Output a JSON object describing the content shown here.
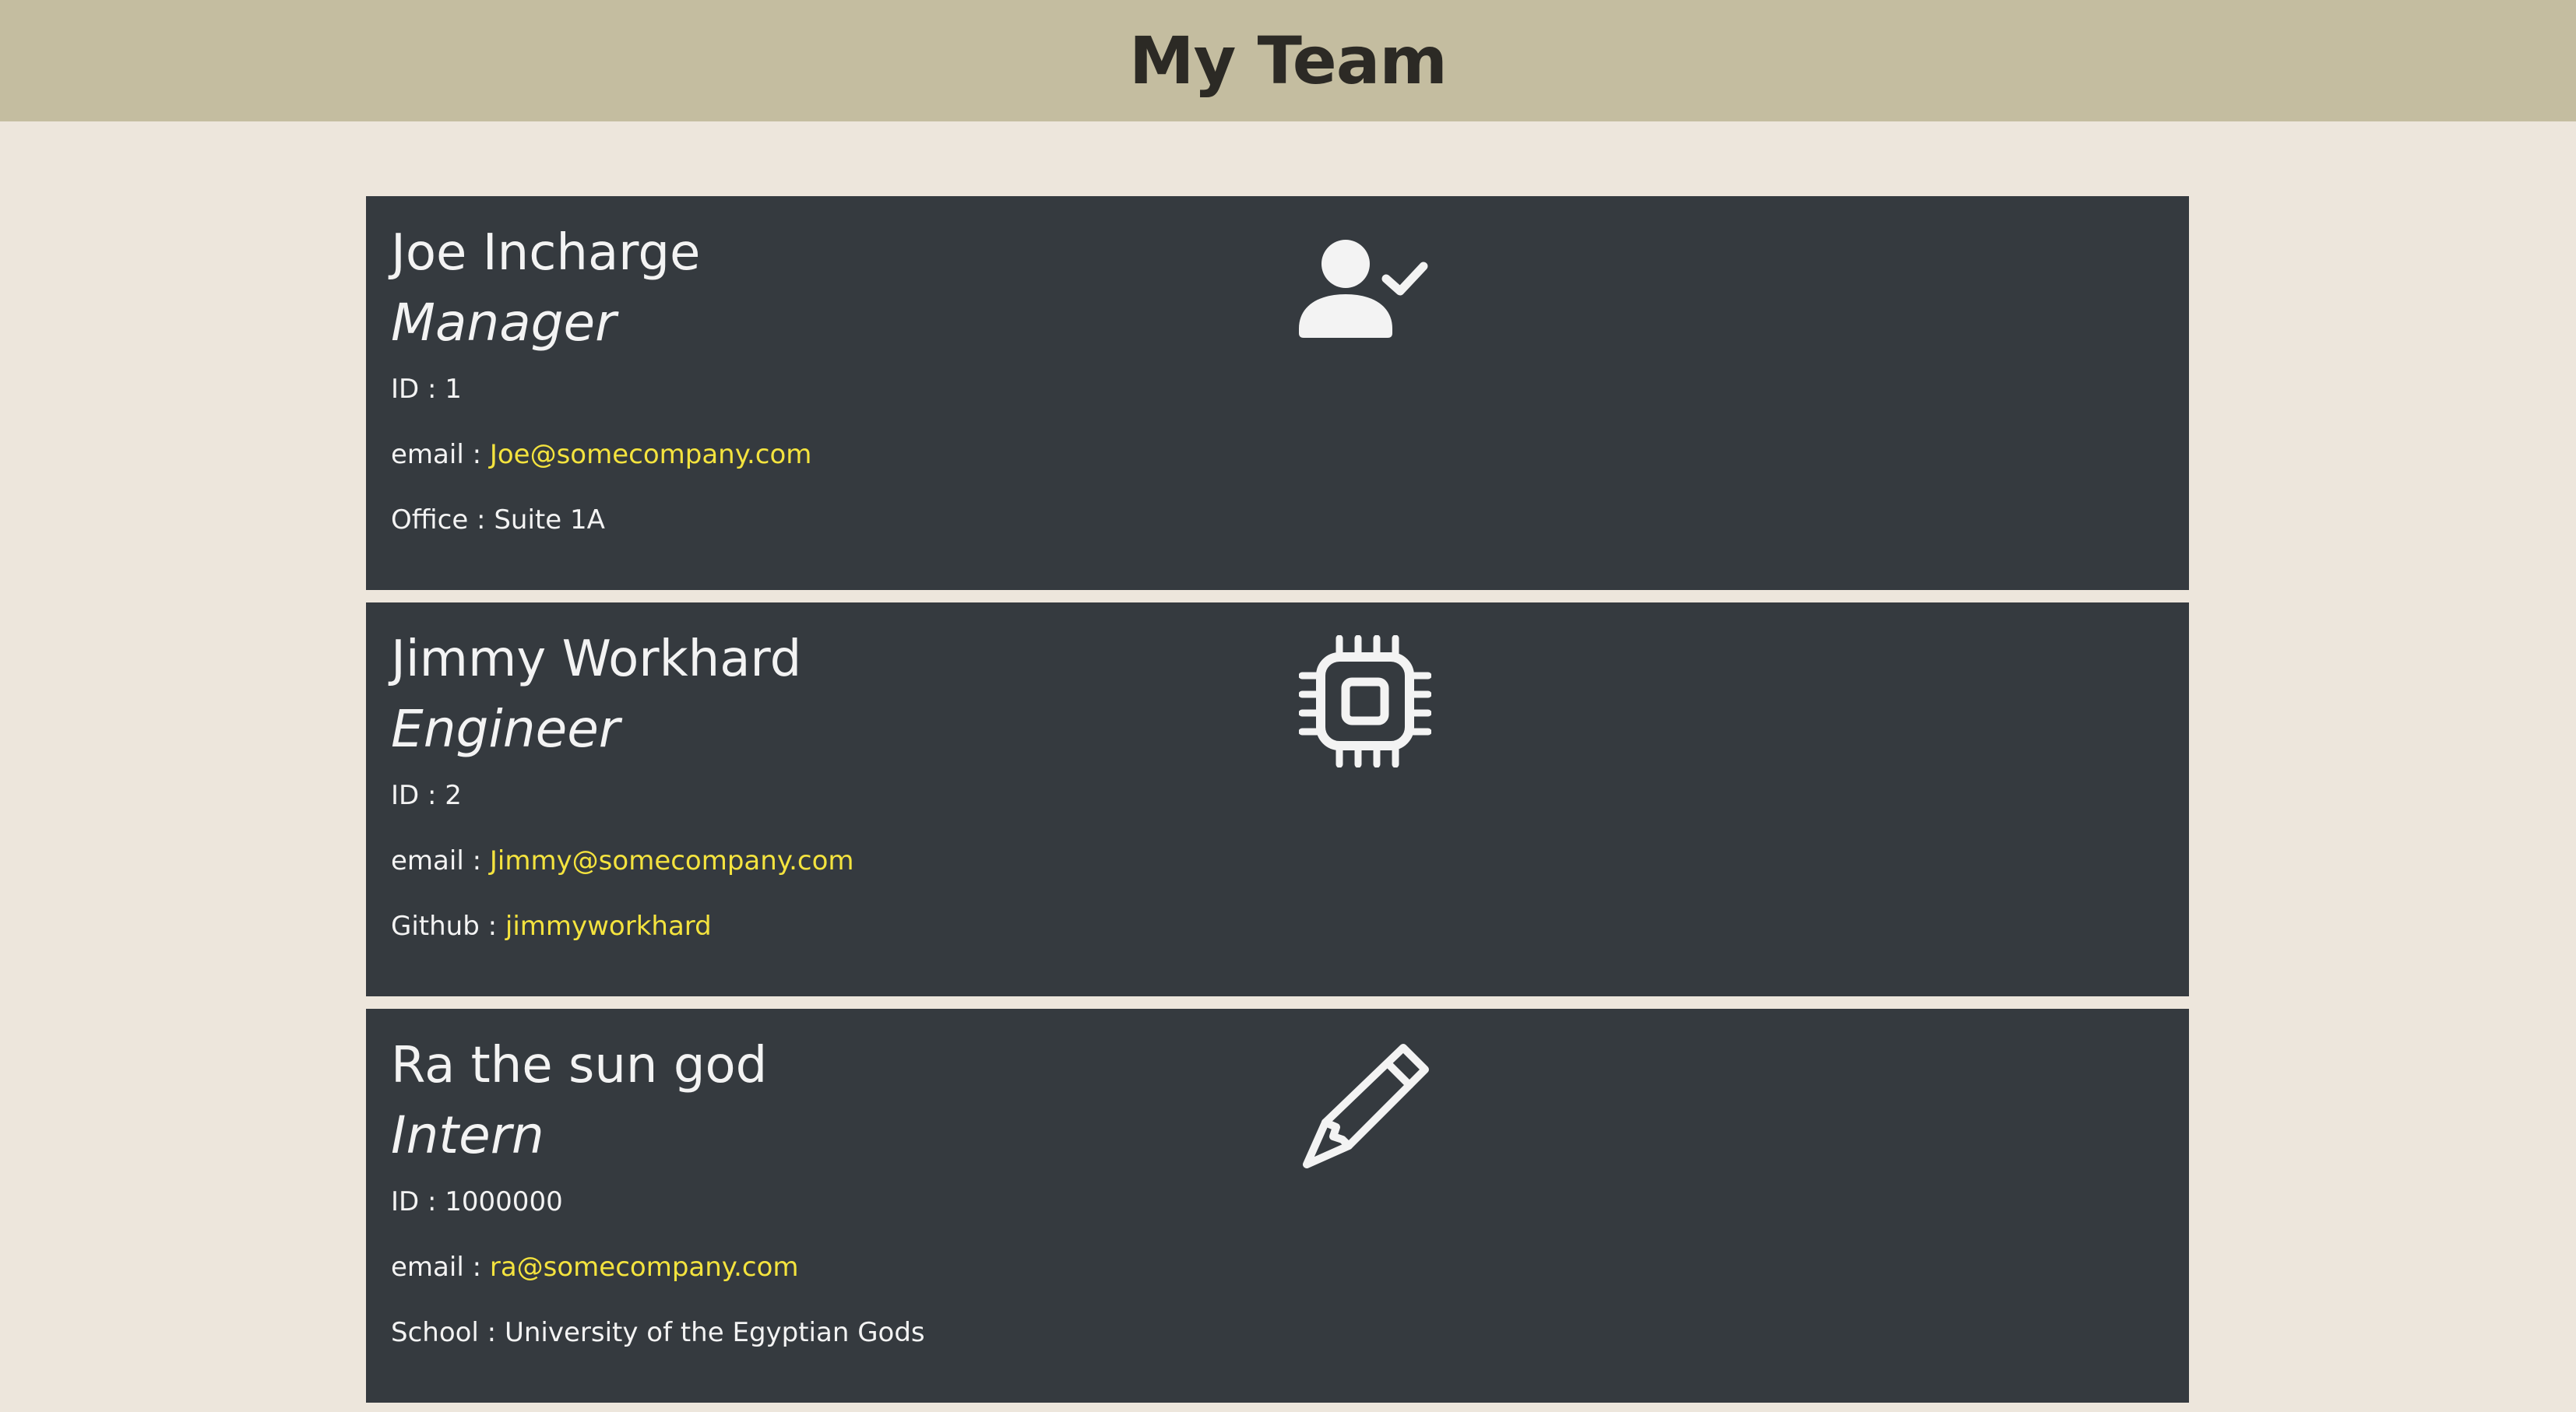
{
  "header": {
    "title": "My Team"
  },
  "employees": [
    {
      "name": "Joe Incharge",
      "role": "Manager",
      "id_label": "ID : ",
      "id": "1",
      "email_label": "email : ",
      "email": "Joe@somecompany.com",
      "extra_label": "Office : ",
      "extra": "Suite 1A",
      "icon": "user-check-icon"
    },
    {
      "name": "Jimmy Workhard",
      "role": "Engineer",
      "id_label": "ID : ",
      "id": "2",
      "email_label": "email : ",
      "email": "Jimmy@somecompany.com",
      "extra_label": "Github : ",
      "extra": "jimmyworkhard",
      "icon": "cpu-chip-icon"
    },
    {
      "name": "Ra the sun god",
      "role": "Intern",
      "id_label": "ID : ",
      "id": "1000000",
      "email_label": "email : ",
      "email": "ra@somecompany.com",
      "extra_label": "School : ",
      "extra": "University of the Egyptian Gods",
      "icon": "pencil-icon"
    }
  ],
  "colors": {
    "page_background": "#ede6dc",
    "header_background": "#c4bda0",
    "card_background": "#353a3f",
    "link": "#f4e33e",
    "text_light": "#f3f3f3"
  }
}
